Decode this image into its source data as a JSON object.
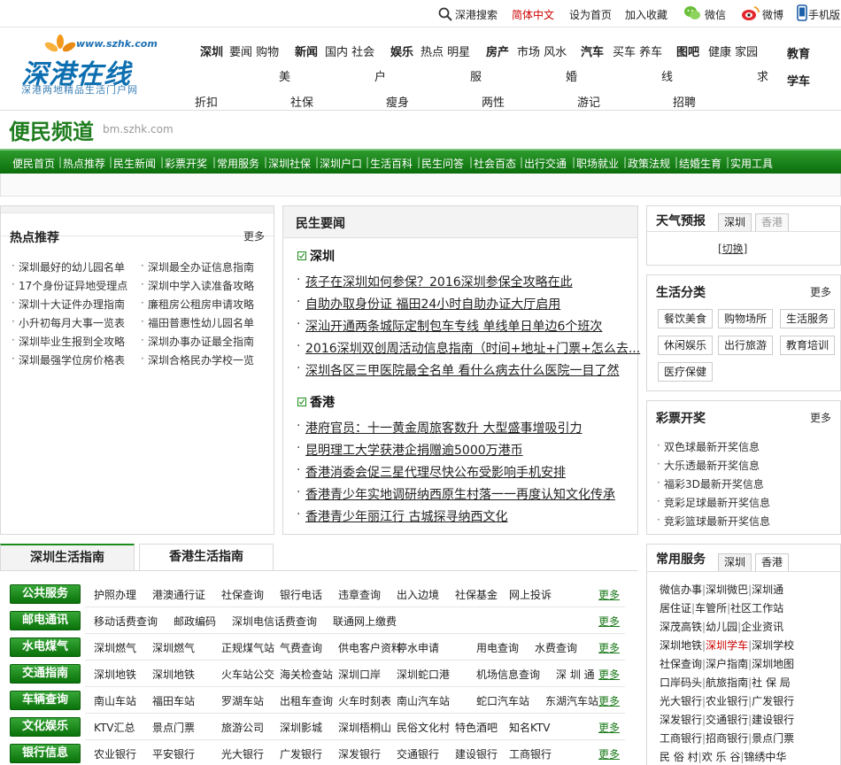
{
  "topbar": {
    "search": "深港搜索",
    "simplified": "简体中文",
    "homepage": "设为首页",
    "favorite": "加入收藏",
    "wechat": "微信",
    "weibo": "微博",
    "mobile": "手机版"
  },
  "logo": {
    "main": "深港在线",
    "url": "www.szhk.com",
    "sub": "深港两地精品生活门户网"
  },
  "nav": {
    "shenzhen": "深圳",
    "shenzhen_sub": "要闻 购物",
    "shenzhen_sub2": "美",
    "news": "新闻",
    "news_sub": "国内 社会",
    "news_sub2": "户",
    "ent": "娱乐",
    "ent_sub": "热点 明星",
    "ent_sub2": "服",
    "house": "房产",
    "house_sub": "市场 风水",
    "house_sub2": "婚",
    "car": "汽车",
    "car_sub": "买车 养车",
    "car_sub2": "线",
    "pic": "图吧",
    "pic_sub": "健康 家园",
    "pic_sub2": "求",
    "edu": "教育",
    "edu2": "学车",
    "row3": [
      "折扣",
      "社保",
      "瘦身",
      "两性",
      "游记",
      "招聘"
    ]
  },
  "channel": {
    "title": "便民频道",
    "domain": "bm.szhk.com"
  },
  "greenbar": [
    "便民首页",
    "热点推荐",
    "民生新闻",
    "彩票开奖",
    "常用服务",
    "深圳社保",
    "深圳户口",
    "生活百科",
    "民生问答",
    "社会百态",
    "出行交通",
    "职场就业",
    "政策法规",
    "结婚生育",
    "实用工具"
  ],
  "hot": {
    "title": "热点推荐",
    "more": "更多",
    "left": [
      "深圳最好的幼儿园名单",
      "17个身份证异地受理点",
      "深圳十大证件办理指南",
      "小升初每月大事一览表",
      "深圳毕业生报到全攻略",
      "深圳最强学位房价格表"
    ],
    "right": [
      "深圳最全办证信息指南",
      "深圳中学入读准备攻略",
      "廉租房公租房申请攻略",
      "福田普惠性幼儿园名单",
      "深圳办事办证最全指南",
      "深圳合格民办学校一览"
    ]
  },
  "news": {
    "title": "民生要闻",
    "sec1": "深圳",
    "sec1_items": [
      "孩子在深圳如何参保？2016深圳参保全攻略在此",
      "自助办取身份证 福田24小时自助办证大厅启用",
      "深汕开通两条城际定制包车专线 单线单日单边6个班次",
      "2016深圳双创周活动信息指南（时间+地址+门票+怎么去...",
      "深圳各区三甲医院最全名单 看什么病去什么医院一目了然"
    ],
    "sec2": "香港",
    "sec2_items": [
      "港府官员：十一黄金周旅客数升 大型盛事增吸引力",
      "昆明理工大学获港企捐赠逾5000万港币",
      "香港消委会促三星代理尽快公布受影响手机安排",
      "香港青少年实地调研纳西原生村落一一再度认知文化传承",
      "香港青少年丽江行 古城探寻纳西文化"
    ]
  },
  "weather": {
    "title": "天气预报",
    "tab1": "深圳",
    "tab2": "香港",
    "switch": "[切换]"
  },
  "life": {
    "title": "生活分类",
    "more": "更多",
    "tags": [
      "餐饮美食",
      "购物场所",
      "生活服务",
      "休闲娱乐",
      "出行旅游",
      "教育培训",
      "医疗保健"
    ]
  },
  "lottery": {
    "title": "彩票开奖",
    "more": "更多",
    "items": [
      "双色球最新开奖信息",
      "大乐透最新开奖信息",
      "福彩3D最新开奖信息",
      "竞彩足球最新开奖信息",
      "竞彩篮球最新开奖信息"
    ]
  },
  "guide": {
    "tab1": "深圳生活指南",
    "tab2": "香港生活指南",
    "more": "更多",
    "rows": [
      {
        "label": "公共服务",
        "cells": [
          "护照办理",
          "港澳通行证",
          "社保查询",
          "银行电话",
          "违章查询",
          "出入边境",
          "社保基金",
          "网上投诉"
        ]
      },
      {
        "label": "邮电通讯",
        "cells": [
          "移动话费查询",
          "邮政编码",
          "深圳电信话费查询",
          "联通网上缴费"
        ]
      },
      {
        "label": "水电煤气",
        "cells": [
          "深圳燃气",
          "深圳燃气",
          "正规煤气站",
          "气费查询",
          "供电客户资料",
          "停水申请",
          "用电查询",
          "水费查询"
        ]
      },
      {
        "label": "交通指南",
        "cells": [
          "深圳地铁",
          "深圳地铁",
          "火车站公交",
          "海关检查站",
          "深圳口岸",
          "深圳蛇口港",
          "机场信息查询",
          "深 圳 通"
        ]
      },
      {
        "label": "车辆查询",
        "cells": [
          "南山车站",
          "福田车站",
          "罗湖车站",
          "出租车查询",
          "火车时刻表",
          "南山汽车站",
          "蛇口汽车站",
          "东湖汽车站"
        ]
      },
      {
        "label": "文化娱乐",
        "cells": [
          "KTV汇总",
          "景点门票",
          "旅游公司",
          "深圳影城",
          "深圳梧桐山",
          "民俗文化村",
          "特色酒吧",
          "知名KTV"
        ]
      },
      {
        "label": "银行信息",
        "cells": [
          "农业银行",
          "平安银行",
          "光大银行",
          "广发银行",
          "深发银行",
          "交通银行",
          "建设银行",
          "工商银行"
        ]
      }
    ]
  },
  "services": {
    "title": "常用服务",
    "tab1": "深圳",
    "tab2": "香港",
    "rows": [
      [
        "微信办事",
        "深圳微巴",
        "深圳通"
      ],
      [
        "居住证",
        "车管所",
        "社区工作站"
      ],
      [
        "深茂高铁",
        "幼儿园",
        "企业资讯"
      ],
      [
        "深圳地铁",
        "深圳学车",
        "深圳学校"
      ],
      [
        "社保查询",
        "深户指南",
        "深圳地图"
      ],
      [
        "口岸码头",
        "航旅指南",
        "社 保 局"
      ],
      [
        "光大银行",
        "农业银行",
        "广发银行"
      ],
      [
        "深发银行",
        "交通银行",
        "建设银行"
      ],
      [
        "工商银行",
        "招商银行",
        "景点门票"
      ],
      [
        "民 俗 村",
        "欢 乐 谷",
        "锦绣中华"
      ]
    ]
  },
  "colors": {
    "brand_green": "#0b6e0b",
    "logo_blue": "#0d6fb0",
    "highlight_red": "#cc0000"
  }
}
